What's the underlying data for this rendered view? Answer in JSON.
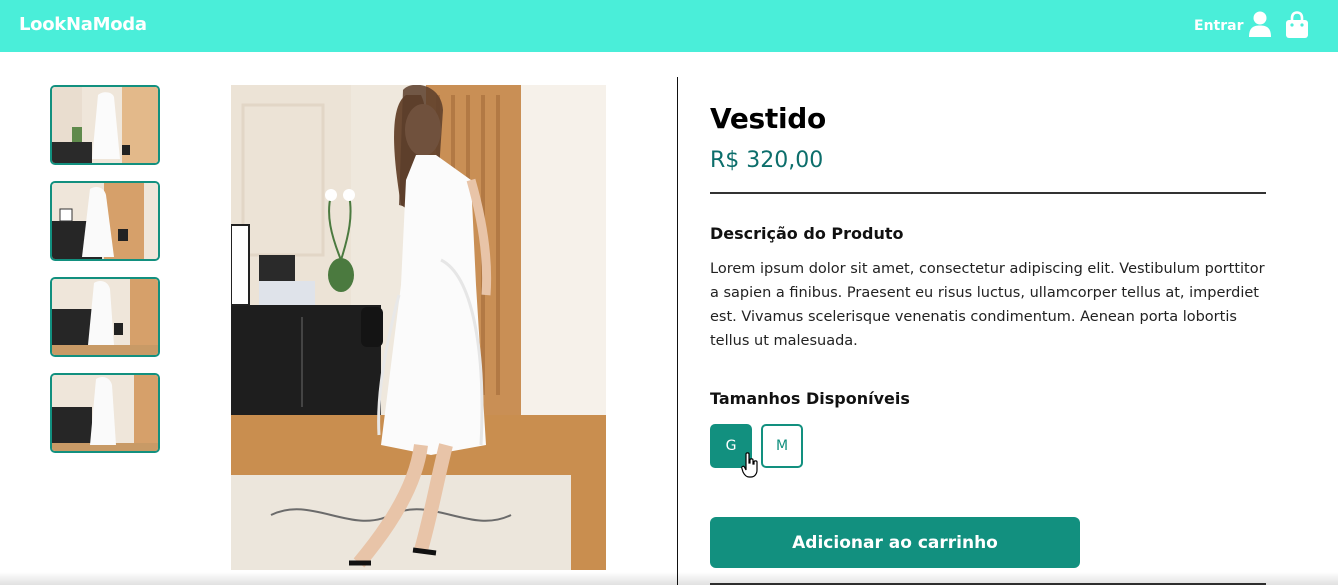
{
  "header": {
    "logo": "LookNaModa",
    "login_label": "Entrar",
    "user_icon": "user-icon",
    "cart_icon": "shopping-bag-icon",
    "background": "#4aeed9"
  },
  "gallery": {
    "thumbnails": [
      "product-photo-1",
      "product-photo-2",
      "product-photo-3",
      "product-photo-4"
    ],
    "main_image": "product-photo-main"
  },
  "product": {
    "name": "Vestido",
    "price": "R$ 320,00",
    "description_heading": "Descrição do Produto",
    "description": "Lorem ipsum dolor sit amet, consectetur adipiscing elit. Vestibulum porttitor a sapien a finibus. Praesent eu risus luctus, ullamcorper tellus at, imperdiet est. Vivamus scelerisque venenatis condimentum. Aenean porta lobortis tellus ut malesuada.",
    "sizes_heading": "Tamanhos Disponíveis",
    "sizes": [
      "G",
      "M"
    ],
    "selected_size": "G",
    "add_to_cart_label": "Adicionar ao carrinho"
  },
  "colors": {
    "accent": "#12907f",
    "price": "#0c6e6b"
  }
}
